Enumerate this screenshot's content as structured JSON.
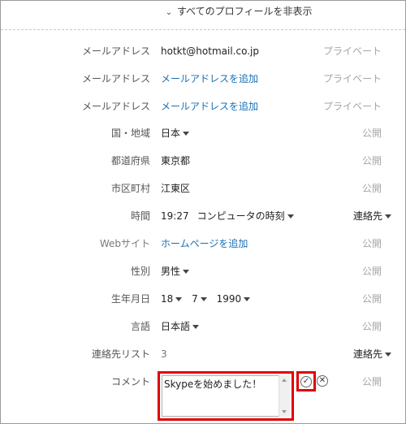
{
  "header": {
    "toggle_label": "すべてのプロフィールを非表示"
  },
  "rows": {
    "email1": {
      "label": "メールアドレス",
      "value": "hotkt@hotmail.co.jp",
      "privacy": "プライベート"
    },
    "email2": {
      "label": "メールアドレス",
      "value": "メールアドレスを追加",
      "privacy": "プライベート"
    },
    "email3": {
      "label": "メールアドレス",
      "value": "メールアドレスを追加",
      "privacy": "プライベート"
    },
    "country": {
      "label": "国・地域",
      "value": "日本",
      "privacy": "公開"
    },
    "prefecture": {
      "label": "都道府県",
      "value": "東京都",
      "privacy": "公開"
    },
    "city": {
      "label": "市区町村",
      "value": "江東区",
      "privacy": "公開"
    },
    "time": {
      "label": "時間",
      "value": "19:27",
      "tz": "コンピュータの時刻",
      "privacy": "連絡先"
    },
    "website": {
      "label": "Webサイト",
      "value": "ホームページを追加",
      "privacy": "公開"
    },
    "gender": {
      "label": "性別",
      "value": "男性",
      "privacy": "公開"
    },
    "birthday": {
      "label": "生年月日",
      "day": "18",
      "month": "7",
      "year": "1990",
      "privacy": "公開"
    },
    "language": {
      "label": "言語",
      "value": "日本語",
      "privacy": "公開"
    },
    "contacts": {
      "label": "連絡先リスト",
      "value": "3",
      "privacy": "連絡先"
    },
    "comment": {
      "label": "コメント",
      "value": "Skypeを始めました！",
      "privacy": "公開"
    }
  },
  "icons": {
    "confirm": "check-icon",
    "cancel": "close-icon"
  },
  "colors": {
    "link": "#1a6fb3",
    "highlight": "#e00000",
    "muted": "#a6a6a6"
  }
}
